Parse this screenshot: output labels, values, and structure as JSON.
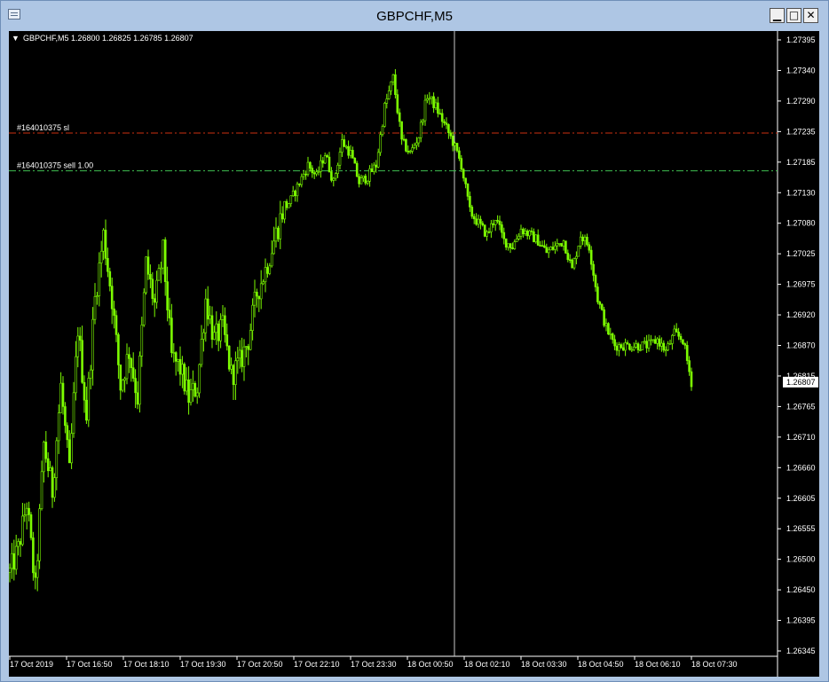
{
  "window": {
    "title": "GBPCHF,M5",
    "buttons": {
      "minimize": "▁",
      "maximize": "□",
      "close": "✕"
    }
  },
  "chart_header": {
    "arrow": "▼",
    "text": "GBPCHF,M5  1.26800 1.26825 1.26785 1.26807"
  },
  "colors": {
    "background": "#000000",
    "candle": "#7CFC00",
    "sl_line": "#cc3010",
    "sell_line": "#3fbf50",
    "crosshair": "#c8c8c8",
    "axis": "#ffffff"
  },
  "order_lines": {
    "sl": {
      "label": "#164010375 sl",
      "price": 1.27235
    },
    "sell": {
      "label": "#164010375 sell 1.00",
      "price": 1.2717
    }
  },
  "current_price": "1.26807",
  "chart_data": {
    "type": "candlestick",
    "symbol": "GBPCHF",
    "timeframe": "M5",
    "ylim": [
      1.26345,
      1.27395
    ],
    "y_ticks": [
      "1.27395",
      "1.27340",
      "1.27290",
      "1.27235",
      "1.27185",
      "1.27130",
      "1.27080",
      "1.27025",
      "1.26975",
      "1.26920",
      "1.26870",
      "1.26815",
      "1.26765",
      "1.26710",
      "1.26660",
      "1.26605",
      "1.26555",
      "1.26500",
      "1.26450",
      "1.26395",
      "1.26345"
    ],
    "x_ticks": [
      "17 Oct 2019",
      "17 Oct 16:50",
      "17 Oct 18:10",
      "17 Oct 19:30",
      "17 Oct 20:50",
      "17 Oct 22:10",
      "17 Oct 23:30",
      "18 Oct 00:50",
      "18 Oct 02:10",
      "18 Oct 03:30",
      "18 Oct 04:50",
      "18 Oct 06:10",
      "18 Oct 07:30"
    ],
    "close_path": [
      [
        0,
        1.2648
      ],
      [
        4,
        1.2652
      ],
      [
        8,
        1.266
      ],
      [
        12,
        1.2645
      ],
      [
        16,
        1.267
      ],
      [
        20,
        1.2662
      ],
      [
        24,
        1.268
      ],
      [
        28,
        1.2665
      ],
      [
        32,
        1.269
      ],
      [
        36,
        1.2675
      ],
      [
        40,
        1.2695
      ],
      [
        44,
        1.2706
      ],
      [
        48,
        1.2695
      ],
      [
        52,
        1.268
      ],
      [
        56,
        1.2686
      ],
      [
        60,
        1.2678
      ],
      [
        64,
        1.2701
      ],
      [
        68,
        1.2694
      ],
      [
        72,
        1.2703
      ],
      [
        76,
        1.2685
      ],
      [
        80,
        1.2683
      ],
      [
        84,
        1.2678
      ],
      [
        88,
        1.268
      ],
      [
        92,
        1.2695
      ],
      [
        96,
        1.2688
      ],
      [
        100,
        1.269
      ],
      [
        104,
        1.2682
      ],
      [
        108,
        1.2684
      ],
      [
        112,
        1.2688
      ],
      [
        116,
        1.2696
      ],
      [
        120,
        1.27
      ],
      [
        124,
        1.2705
      ],
      [
        128,
        1.271
      ],
      [
        132,
        1.2712
      ],
      [
        136,
        1.2715
      ],
      [
        140,
        1.2718
      ],
      [
        144,
        1.2716
      ],
      [
        148,
        1.272
      ],
      [
        152,
        1.2715
      ],
      [
        156,
        1.2722
      ],
      [
        160,
        1.272
      ],
      [
        164,
        1.2715
      ],
      [
        168,
        1.2716
      ],
      [
        172,
        1.2718
      ],
      [
        176,
        1.2728
      ],
      [
        180,
        1.2733
      ],
      [
        184,
        1.2722
      ],
      [
        188,
        1.272
      ],
      [
        192,
        1.2723
      ],
      [
        196,
        1.273
      ],
      [
        200,
        1.2728
      ],
      [
        204,
        1.2725
      ],
      [
        208,
        1.2722
      ],
      [
        212,
        1.2718
      ],
      [
        216,
        1.271
      ],
      [
        220,
        1.2708
      ],
      [
        224,
        1.2706
      ],
      [
        228,
        1.2709
      ],
      [
        232,
        1.2705
      ],
      [
        236,
        1.2704
      ],
      [
        240,
        1.2707
      ],
      [
        244,
        1.2706
      ],
      [
        248,
        1.2705
      ],
      [
        252,
        1.2703
      ],
      [
        256,
        1.2704
      ],
      [
        260,
        1.2705
      ],
      [
        264,
        1.27
      ],
      [
        268,
        1.2706
      ],
      [
        272,
        1.2704
      ],
      [
        276,
        1.2695
      ],
      [
        280,
        1.269
      ],
      [
        284,
        1.2687
      ],
      [
        288,
        1.2687
      ],
      [
        292,
        1.2687
      ],
      [
        296,
        1.2687
      ],
      [
        300,
        1.2687
      ],
      [
        304,
        1.2688
      ],
      [
        308,
        1.2686
      ],
      [
        312,
        1.2689
      ],
      [
        316,
        1.2688
      ],
      [
        320,
        1.26807
      ]
    ],
    "grid": false
  }
}
